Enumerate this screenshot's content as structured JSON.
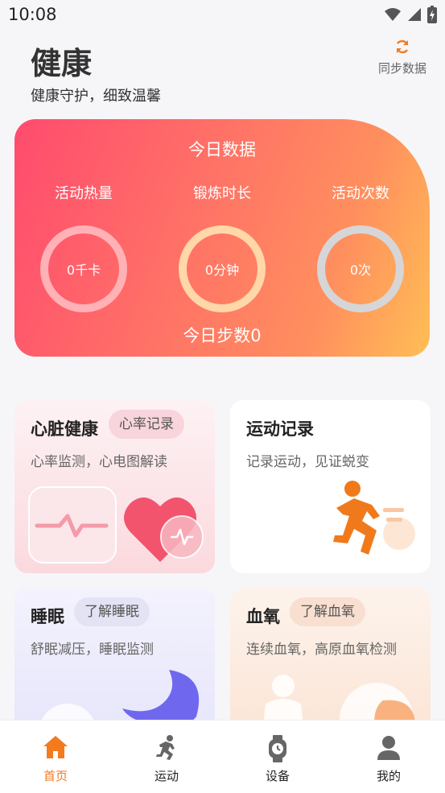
{
  "status": {
    "time": "10:08"
  },
  "header": {
    "title": "健康",
    "subtitle": "健康守护，细致温馨",
    "sync_label": "同步数据"
  },
  "today": {
    "title": "今日数据",
    "metrics": [
      {
        "label": "活动热量",
        "value": "0千卡"
      },
      {
        "label": "锻炼时长",
        "value": "0分钟"
      },
      {
        "label": "活动次数",
        "value": "0次"
      }
    ],
    "steps": "今日步数0"
  },
  "cards": {
    "heart": {
      "title": "心脏健康",
      "tag": "心率记录",
      "desc": "心率监测，心电图解读"
    },
    "sport": {
      "title": "运动记录",
      "desc": "记录运动，见证蜕变"
    },
    "sleep": {
      "title": "睡眠",
      "tag": "了解睡眠",
      "desc": "舒眠减压，睡眠监测"
    },
    "oxygen": {
      "title": "血氧",
      "tag": "了解血氧",
      "desc": "连续血氧，高原血氧检测"
    }
  },
  "tabs": [
    {
      "label": "首页",
      "icon": "home-icon",
      "active": true
    },
    {
      "label": "运动",
      "icon": "running-icon"
    },
    {
      "label": "设备",
      "icon": "watch-icon"
    },
    {
      "label": "我的",
      "icon": "user-icon"
    }
  ],
  "colors": {
    "accent": "#f37a1d",
    "card_gradient_start": "#ff4b6e",
    "card_gradient_end": "#ffbe55"
  }
}
